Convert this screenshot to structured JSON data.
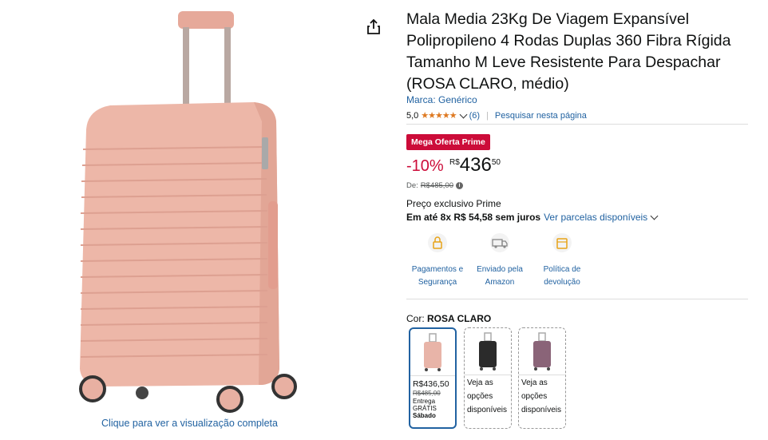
{
  "product": {
    "title": "Mala Media 23Kg De Viagem Expansível Polipropileno 4 Rodas Duplas 360 Fibra Rígida Tamanho M Leve Resistente Para Despachar (ROSA CLARO, médio)",
    "brand": "Marca: Genérico",
    "rating": "5,0",
    "stars": "★★★★★",
    "review_count": "(6)",
    "search_page": "Pesquisar nesta página"
  },
  "pricing": {
    "deal_badge": "Mega Oferta Prime",
    "discount": "-10%",
    "currency": "R$",
    "whole": "436",
    "fraction": "50",
    "list_label": "De:",
    "list_price": "R$485,00",
    "prime_exclusive": "Preço exclusivo Prime",
    "installments": "Em até 8x R$ 54,58 sem juros",
    "installments_link": "Ver parcelas disponíveis"
  },
  "trust": [
    {
      "line1": "Pagamentos e",
      "line2": "Segurança",
      "icon": "lock-icon"
    },
    {
      "line1": "Enviado pela",
      "line2": "Amazon",
      "icon": "delivery-truck-icon"
    },
    {
      "line1": "Política de",
      "line2": "devolução",
      "icon": "return-box-icon"
    }
  ],
  "color": {
    "label": "Cor:",
    "selected": "ROSA CLARO"
  },
  "swatches": [
    {
      "price": "R$436,50",
      "old_price": "R$485,00",
      "delivery": "Entrega",
      "free": "GRÁTIS",
      "day": "Sábado",
      "color": "#E8B4A8"
    },
    {
      "l1": "Veja as",
      "l2": "opções",
      "l3": "disponíveis",
      "color": "#2B2B2B"
    },
    {
      "l1": "Veja as",
      "l2": "opções",
      "l3": "disponíveis",
      "color": "#8A6478"
    }
  ],
  "gallery": {
    "full_view": "Clique para ver a visualização completa",
    "main_color": "#EDB7A8"
  },
  "colors": {
    "link": "#2162A1",
    "deal": "#CC0C39",
    "star": "#DE7921"
  }
}
